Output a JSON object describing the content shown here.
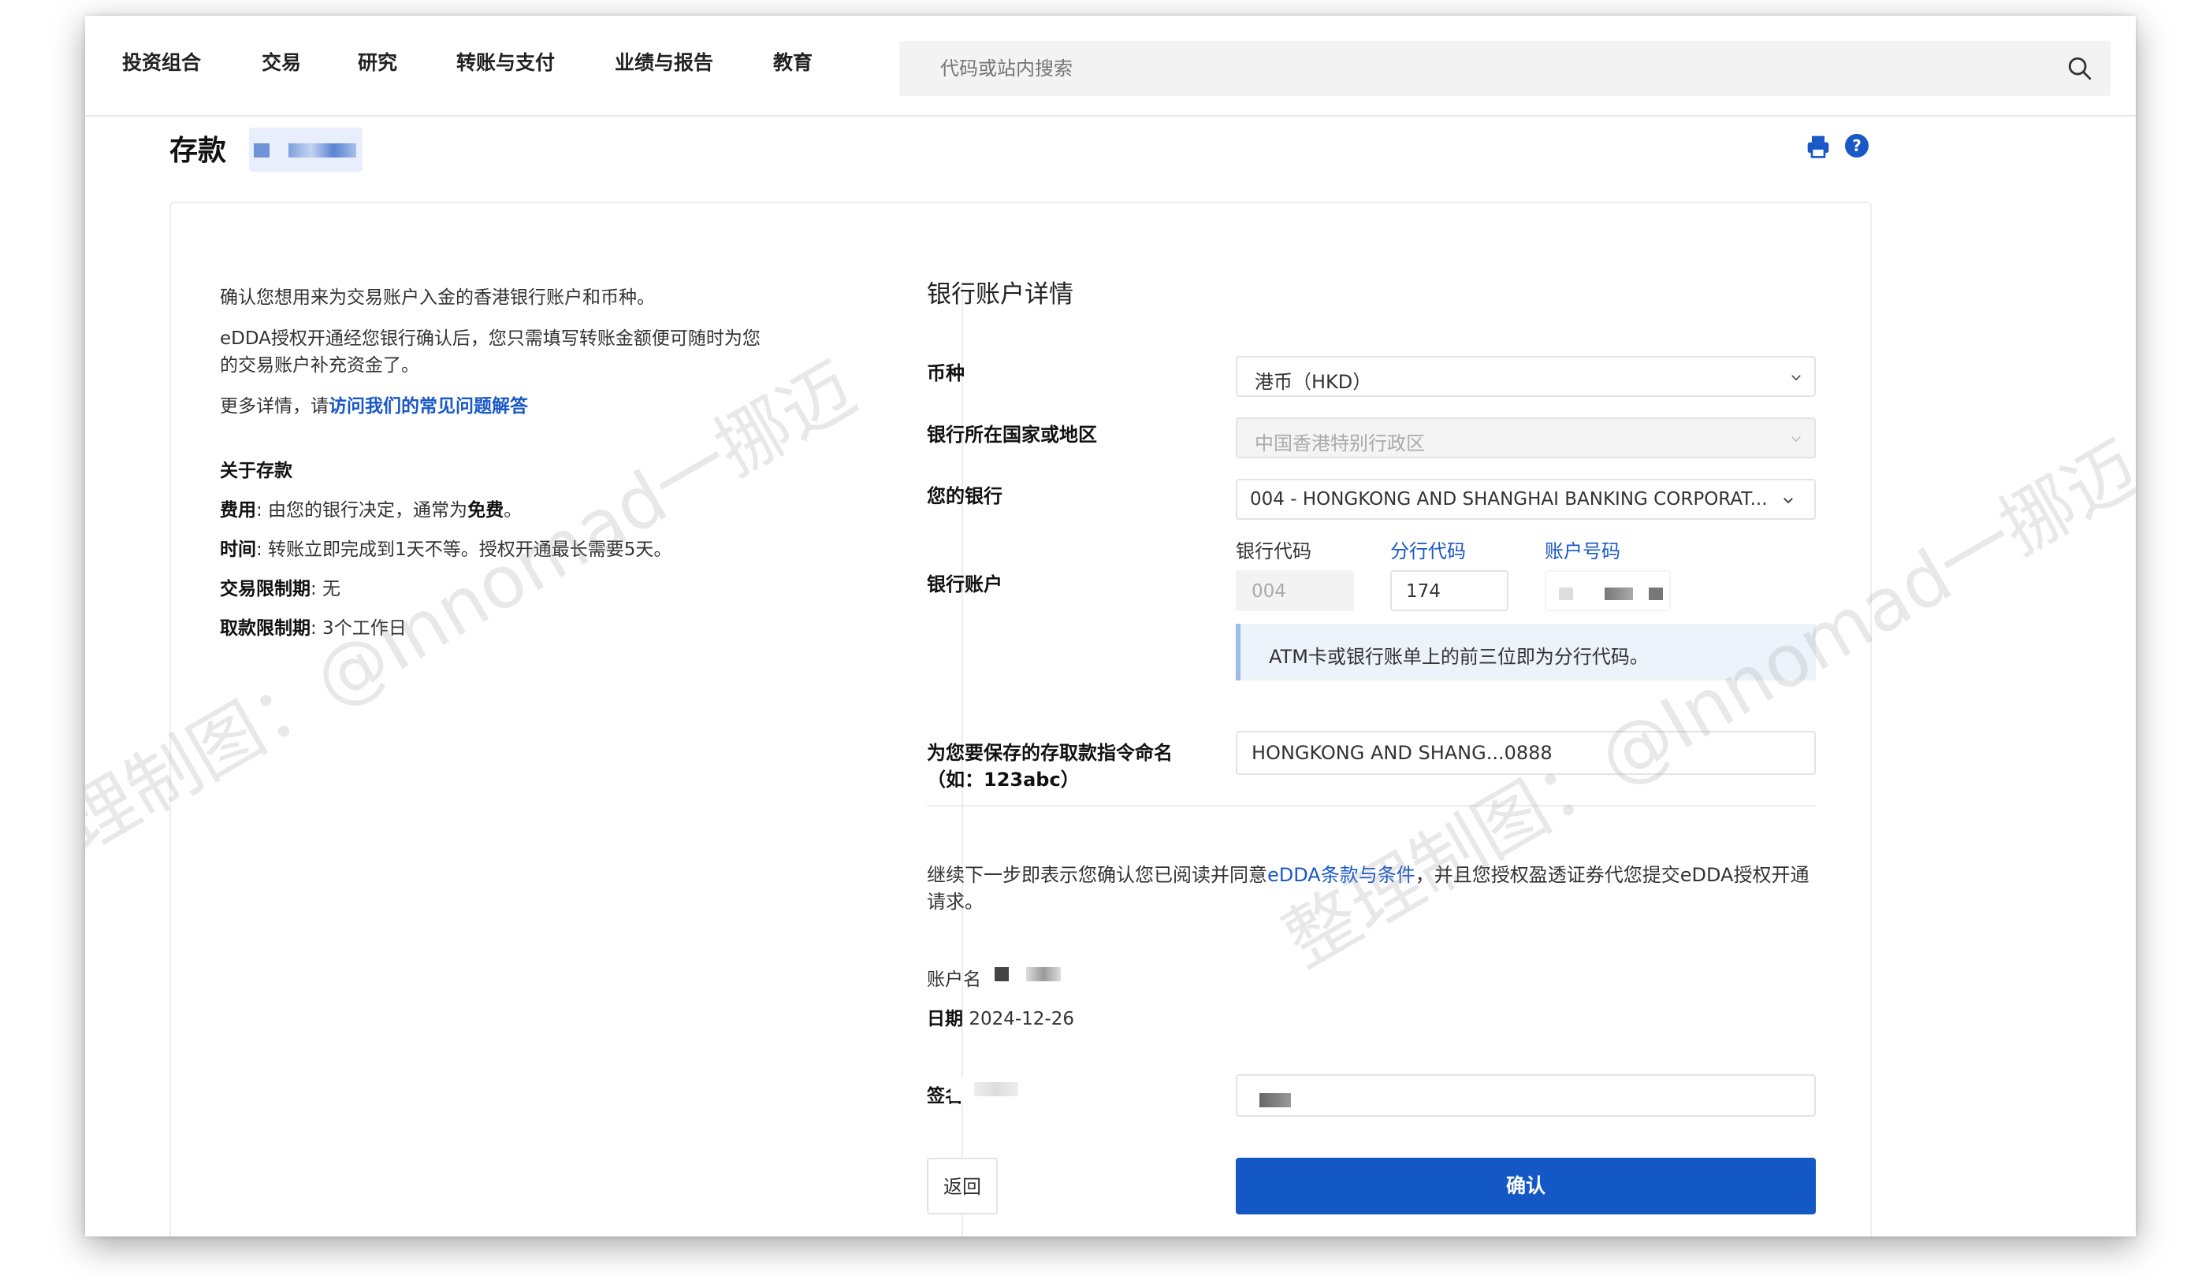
{
  "nav": {
    "items": [
      "投资组合",
      "交易",
      "研究",
      "转账与支付",
      "业绩与报告",
      "教育"
    ],
    "search_placeholder": "代码或站内搜索"
  },
  "page": {
    "title": "存款"
  },
  "left": {
    "intro1": "确认您想用来为交易账户入金的香港银行账户和币种。",
    "intro2_line1": "eDDA授权开通经您银行确认后，您只需填写转账金额便可随时为您",
    "intro2_line2": "的交易账户补充资金了。",
    "more_prefix": "更多详情，请",
    "more_link": "访问我们的常见问题解答",
    "about_title": "关于存款",
    "fee_label": "费用",
    "fee_text": ": 由您的银行决定，通常为",
    "fee_free": "免费",
    "fee_end": "。",
    "time_label": "时间",
    "time_text": ": 转账立即完成到1天不等。授权开通最长需要5天。",
    "trade_limit_label": "交易限制期",
    "trade_limit_text": ": 无",
    "withdraw_limit_label": "取款限制期",
    "withdraw_limit_text": ": 3个工作日"
  },
  "form": {
    "section_title": "银行账户详情",
    "currency_label": "币种",
    "currency_value": "港币（HKD）",
    "country_label": "银行所在国家或地区",
    "country_value": "中国香港特别行政区",
    "bank_label": "您的银行",
    "bank_value": "004 - HONGKONG AND SHANGHAI BANKING CORPORAT...",
    "account_label": "银行账户",
    "bank_code_label": "银行代码",
    "bank_code_value": "004",
    "branch_code_label": "分行代码",
    "branch_code_value": "174",
    "account_no_label": "账户号码",
    "hint": "ATM卡或银行账单上的前三位即为分行代码。",
    "instruction_label_line1": "为您要保存的存取款指令命名",
    "instruction_label_line2": "（如：123abc）",
    "instruction_value": "HONGKONG AND SHANG...0888",
    "consent_prefix": "继续下一步即表示您确认您已阅读并同意",
    "consent_link": "eDDA条款与条件",
    "consent_suffix": "，并且您授权盈透证券代您提交eDDA授权开通请求。",
    "account_name_label": "账户名",
    "date_label": "日期",
    "date_value": "2024-12-26",
    "signature_label": "签名",
    "back_button": "返回",
    "confirm_button": "确认"
  },
  "watermark": "整理制图：@Innomad一挪迈",
  "colors": {
    "accent": "#1358c5",
    "link": "#1958c7"
  }
}
